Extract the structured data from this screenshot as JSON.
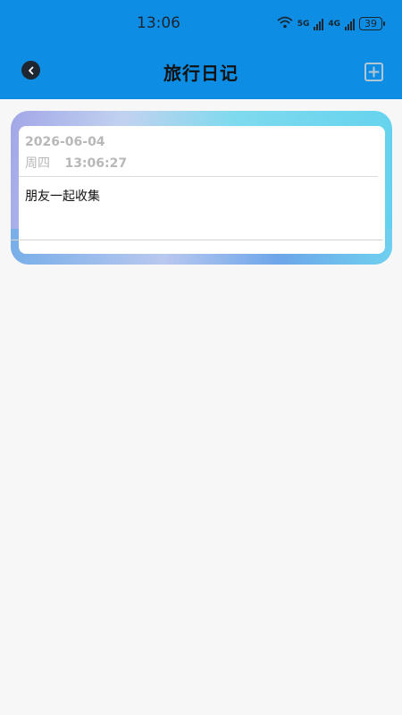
{
  "status_bar": {
    "time": "13:06",
    "network_a": "5G",
    "network_b": "4G",
    "wifi_badge": "6",
    "battery": "39"
  },
  "header": {
    "title": "旅行日记",
    "back_icon": "chevron-left-icon",
    "add_icon": "plus-square-icon",
    "background_color": "#0d8ee4"
  },
  "entries": [
    {
      "date": "2026-06-04",
      "weekday": "周四",
      "time": "13:06:27",
      "content": "朋友一起收集"
    }
  ]
}
